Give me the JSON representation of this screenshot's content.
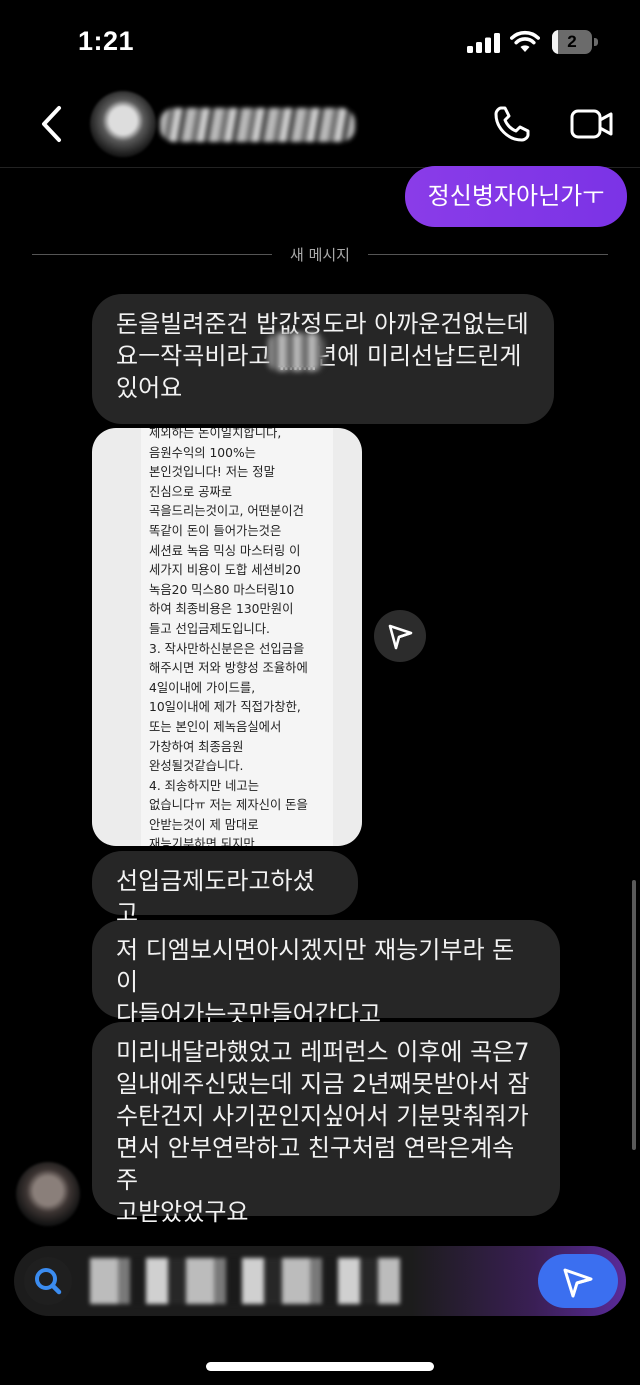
{
  "status": {
    "time": "1:21",
    "battery": "2",
    "battery_level": 0.15
  },
  "header": {
    "contact_name": "",
    "icons": [
      "back-arrow-icon",
      "phone-icon",
      "video-camera-icon"
    ]
  },
  "sent_message": "정신병자아닌가ㅜ",
  "divider": "새 메시지",
  "messages": [
    "돈을빌려준건 밥값정도라 아까운건없는데\n요ㅡ작곡비라고 ▒▒년에 미리선납드린게\n있어요",
    "선입금제도라고하셨고",
    "저 디엠보시면아시겠지만 재능기부라 돈이\n다들어가는곳만들어간다고",
    "미리내달라했었고 레퍼런스 이후에 곡은7\n일내에주신댔는데 지금 2년째못받아서 잠\n수탄건지 사기꾼인지싶어서 기분맞춰줘가\n면서 안부연락하고 친구처럼 연락은계속주\n고받았었구요"
  ],
  "attachment_text": "제외하는 돈이일치합니다,\n음원수익의 100%는\n본인것입니다! 저는 정말\n진심으로 공짜로\n곡을드리는것이고, 어떤분이건\n똑같이 돈이 들어가는것은\n세션료 녹음 믹싱 마스터링 이\n세가지 비용이 도합 세션비20\n녹음20 믹스80 마스터링10\n하여 최종비용은 130만원이\n들고 선입금제도입니다.\n3. 작사만하신분은은 선입금을\n해주시면 저와 방향성 조율하에\n4일이내에 가이드를,\n10일이내에 제가 직접가창한,\n또는 본인이 제녹음실에서\n가창하여 최종음원\n완성될것같습니다.\n4. 죄송하지만 네고는\n없습니다ㅠ 저는 제자신이 돈을\n안받는것이 제 맘대로\n재능기부하면 되지만,\n나머지부분은 제가 함부로\n시세를 깎거나 하는일은\n가뭄이나 어려운 세션업계\n음악업계에 좋은 영향이아니기",
  "composer": {
    "placeholder": ""
  },
  "colors": {
    "sent_bubble": "#8a3ce8",
    "received_bubble": "#262626",
    "send_button": "#3b6ff0",
    "background": "#000000"
  }
}
